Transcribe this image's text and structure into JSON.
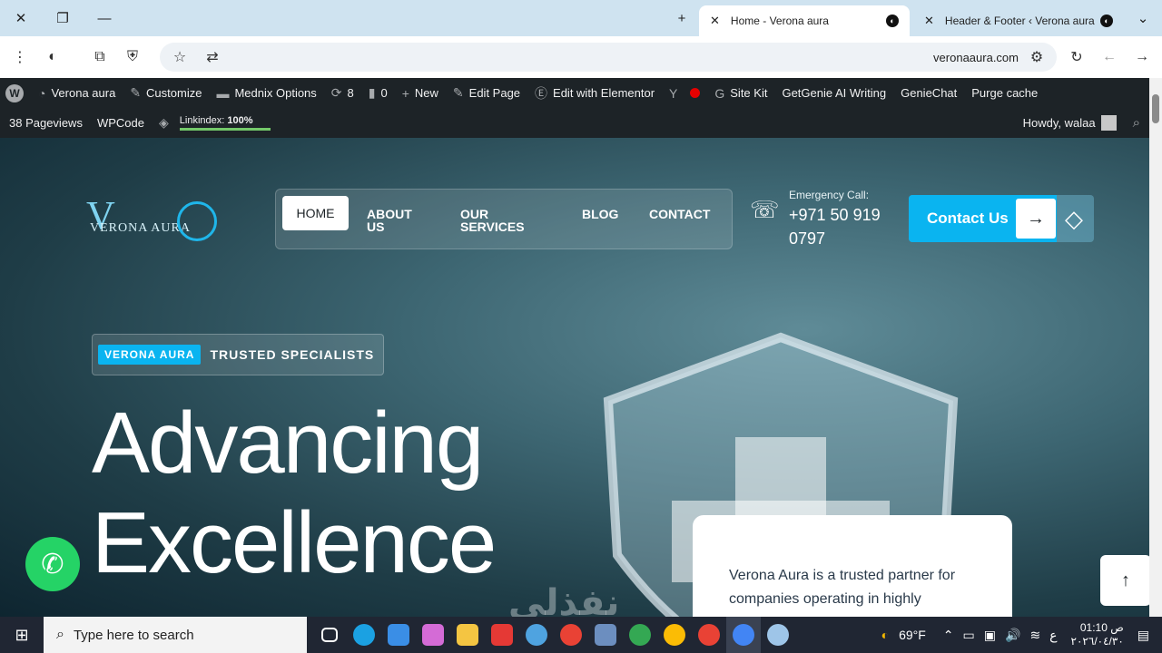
{
  "browser": {
    "tabs": [
      {
        "title": "Home - Verona aura",
        "active": true
      },
      {
        "title": "Header & Footer ‹ Verona aura",
        "active": false
      }
    ],
    "url": "veronaaura.com"
  },
  "wp_admin_bar": {
    "row1": [
      {
        "label": "Verona aura",
        "icon": "dashboard-icon"
      },
      {
        "label": "Customize",
        "icon": "brush-icon"
      },
      {
        "label": "Mednix Options",
        "icon": "folder-icon"
      },
      {
        "label": "8",
        "icon": "updates-icon"
      },
      {
        "label": "0",
        "icon": "comment-icon"
      },
      {
        "label": "New",
        "icon": "plus-icon"
      },
      {
        "label": "Edit Page",
        "icon": "pencil-icon"
      },
      {
        "label": "Edit with Elementor",
        "icon": "elementor-icon"
      },
      {
        "label": "Site Kit",
        "icon": "google-icon"
      },
      {
        "label": "GetGenie AI Writing",
        "icon": ""
      },
      {
        "label": "GenieChat",
        "icon": ""
      },
      {
        "label": "Purge cache",
        "icon": ""
      }
    ],
    "row2": {
      "pageviews": "38 Pageviews",
      "wpcode": "WPCode",
      "linkindex_label": "Linkindex:",
      "linkindex_value": "100%",
      "linkindex_progress": 1.0,
      "howdy": "Howdy, walaa"
    }
  },
  "site": {
    "logo_text": "VERONA AURA",
    "logo_letter": "V",
    "nav": [
      {
        "label": "HOME",
        "active": true
      },
      {
        "label": "ABOUT US",
        "active": false
      },
      {
        "label": "OUR SERVICES",
        "active": false
      },
      {
        "label": "BLOG",
        "active": false
      },
      {
        "label": "CONTACT",
        "active": false
      }
    ],
    "emergency_label": "Emergency Call:",
    "emergency_number": "+971 50 919 0797",
    "cta_label": "Contact Us",
    "tag_pill": "VERONA AURA",
    "tag_text": "TRUSTED SPECIALISTS",
    "headline_line1": "Advancing",
    "headline_line2": "Excellence",
    "card_text": "Verona Aura is a trusted partner for companies operating in highly",
    "watermark": "نفذلي"
  },
  "taskbar": {
    "search_placeholder": "Type here to search",
    "weather": "69°F",
    "lang": "ع",
    "time": "01:10 ص",
    "date": "٢٠٢٦/٠٤/٣٠"
  },
  "colors": {
    "accent": "#0ab4f0",
    "wp_bar": "#1d2327",
    "whatsapp": "#25d366"
  }
}
